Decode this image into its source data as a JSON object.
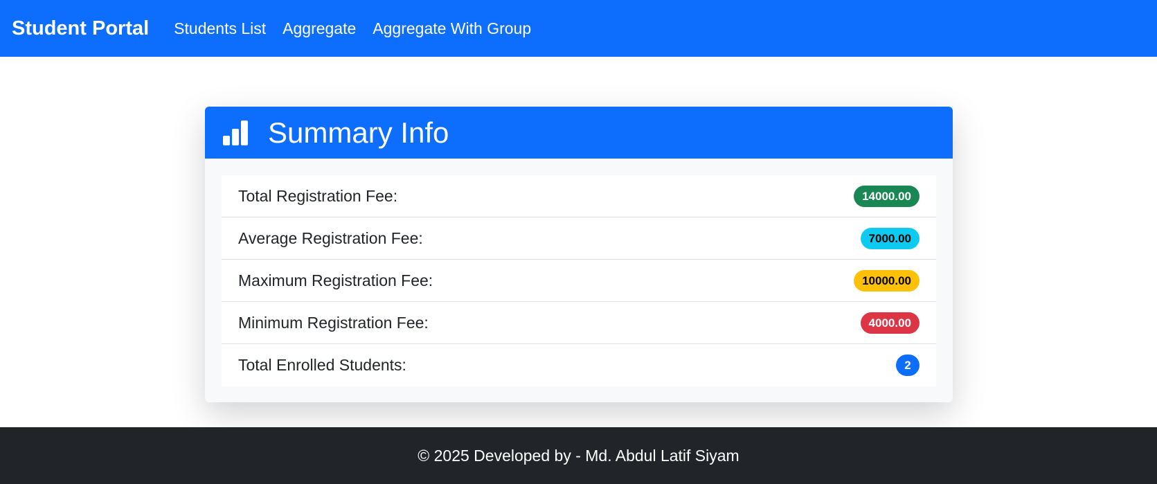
{
  "navbar": {
    "brand": "Student Portal",
    "links": [
      "Students List",
      "Aggregate",
      "Aggregate With Group"
    ],
    "background": "#0d6efd"
  },
  "card": {
    "icon": "bar-chart-icon",
    "title": "Summary Info",
    "items": [
      {
        "label": "Total Registration Fee:",
        "value": "14000.00",
        "badge_bg": "#198754",
        "badge_fg": "#ffffff"
      },
      {
        "label": "Average Registration Fee:",
        "value": "7000.00",
        "badge_bg": "#0dcaf0",
        "badge_fg": "#000000"
      },
      {
        "label": "Maximum Registration Fee:",
        "value": "10000.00",
        "badge_bg": "#ffc107",
        "badge_fg": "#000000"
      },
      {
        "label": "Minimum Registration Fee:",
        "value": "4000.00",
        "badge_bg": "#dc3545",
        "badge_fg": "#ffffff"
      },
      {
        "label": "Total Enrolled Students:",
        "value": "2",
        "badge_bg": "#0d6efd",
        "badge_fg": "#ffffff"
      }
    ]
  },
  "footer": {
    "text": "© 2025 Developed by - Md. Abdul Latif Siyam",
    "background": "#212529"
  }
}
